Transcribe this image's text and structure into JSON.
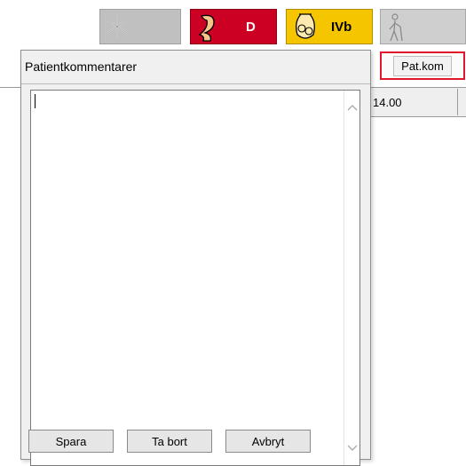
{
  "toolbar": {
    "cells": [
      {
        "name": "snow",
        "icon": "snowflake-icon",
        "color": "#c0c0c0",
        "label": ""
      },
      {
        "name": "diagnosis",
        "icon": "figure-icon",
        "color": "#cc0022",
        "label": "D"
      },
      {
        "name": "infusion",
        "icon": "vase-icon",
        "color": "#f5c500",
        "label": "IVb"
      },
      {
        "name": "walking",
        "icon": "walking-person-icon",
        "color": "#cfcfcf",
        "label": ""
      }
    ]
  },
  "background": {
    "patkom_label": "Pat.kom",
    "time_value": "14.00"
  },
  "dialog": {
    "title": "Patientkommentarer",
    "comment_value": "",
    "buttons": {
      "save": "Spara",
      "delete": "Ta bort",
      "cancel": "Avbryt"
    }
  },
  "colors": {
    "highlight": "#e0162b",
    "dialog_bg": "#f0f0f0"
  }
}
